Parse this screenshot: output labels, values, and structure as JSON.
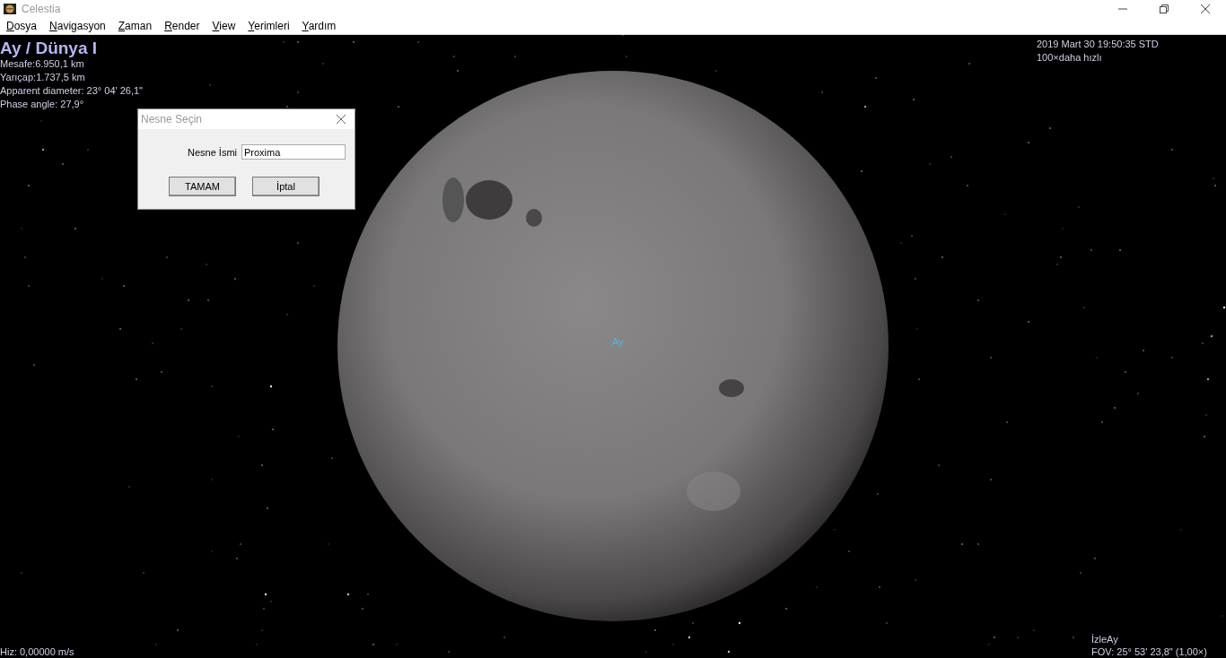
{
  "window": {
    "title": "Celestia"
  },
  "menu": [
    "Dosya",
    "Navigasyon",
    "Zaman",
    "Render",
    "View",
    "Yerimleri",
    "Yardım"
  ],
  "info": {
    "object": "Ay / Dünya I",
    "lines": [
      "Mesafe:6.950,1 km",
      "Yarıçap:1.737,5 km",
      "Apparent diameter: 23° 04' 26,1\"",
      "Phase angle: 27,9°"
    ]
  },
  "time": {
    "date": "2019 Mart 30 19:50:35 STD",
    "rate": "100×daha hızlı"
  },
  "moon_label": "Ay",
  "status": {
    "speed": "Hiz: 0,00000 m/s",
    "mode": "İzleAy",
    "fov": "FOV: 25° 53' 23,8\" (1,00×)"
  },
  "dialog": {
    "title": "Nesne Seçin",
    "field_label": "Nesne İsmi",
    "field_value": "Proxima",
    "buttons": [
      "TAMAM",
      "İptal"
    ]
  }
}
